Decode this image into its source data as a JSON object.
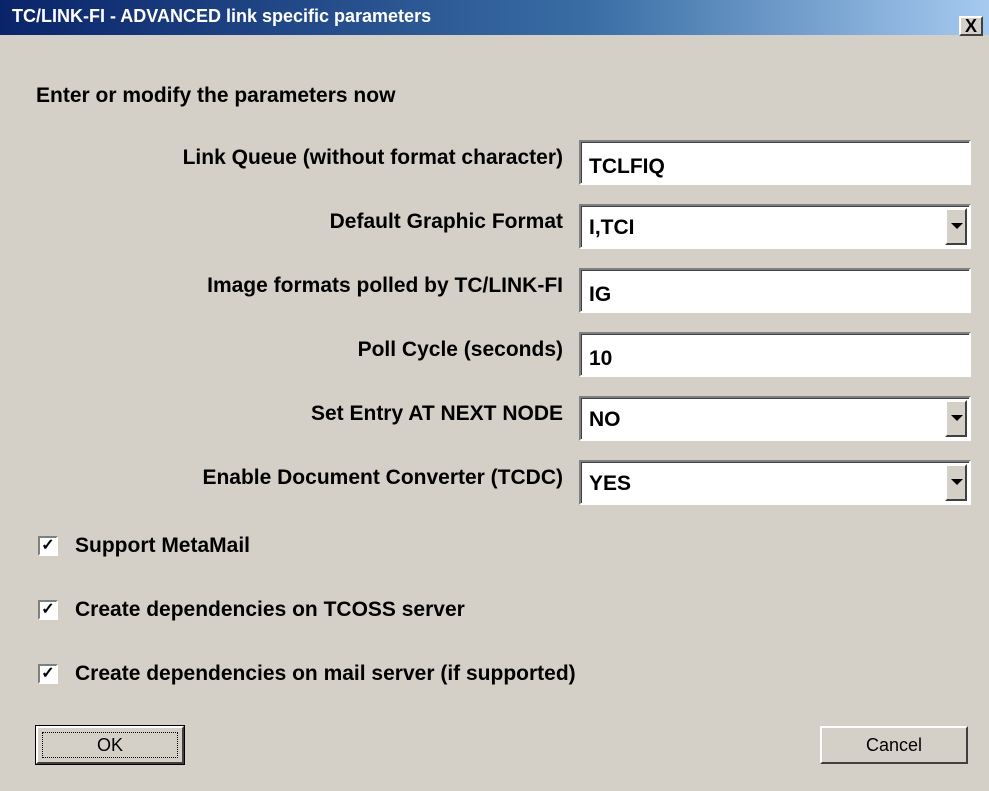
{
  "window": {
    "title": "TC/LINK-FI - ADVANCED link specific parameters",
    "close_symbol": "X"
  },
  "instruction": "Enter or modify the parameters now",
  "fields": {
    "link_queue": {
      "label": "Link Queue (without format character)",
      "value": "TCLFIQ"
    },
    "default_graphic_format": {
      "label": "Default Graphic Format",
      "value": "I,TCI"
    },
    "image_formats": {
      "label": "Image formats polled by TC/LINK-FI",
      "value": "IG"
    },
    "poll_cycle": {
      "label": "Poll Cycle (seconds)",
      "value": "10"
    },
    "set_entry": {
      "label": "Set Entry AT NEXT NODE",
      "value": "NO"
    },
    "enable_converter": {
      "label": "Enable Document Converter (TCDC)",
      "value": "YES"
    }
  },
  "checkboxes": {
    "support_metamail": {
      "label": "Support MetaMail",
      "checked": true,
      "mark": "✓"
    },
    "tcoss_dependencies": {
      "label": "Create dependencies on TCOSS server",
      "checked": true,
      "mark": "✓"
    },
    "mail_dependencies": {
      "label": "Create dependencies on mail server (if supported)",
      "checked": true,
      "mark": "✓"
    }
  },
  "buttons": {
    "ok": "OK",
    "cancel": "Cancel"
  }
}
